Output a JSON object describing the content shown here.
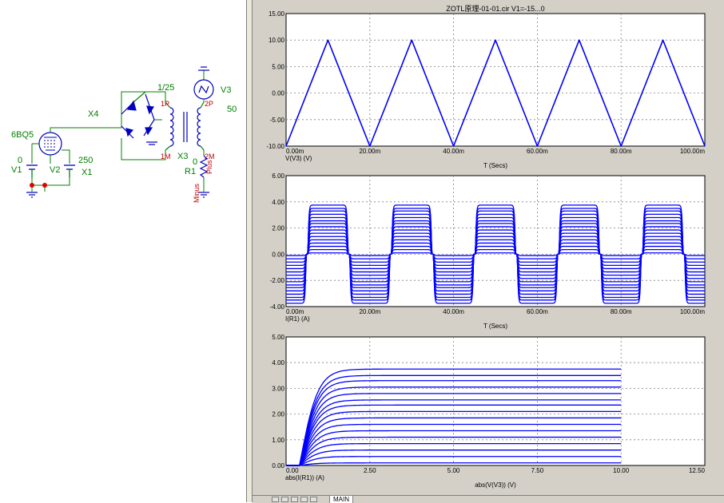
{
  "schematic": {
    "tube_label": "6BQ5",
    "v1_name": "V1",
    "v1_value": "0",
    "v2_name": "V2",
    "v2_value": "250",
    "x1_label": "X1",
    "x4_label": "X4",
    "ratio_label": "1/25",
    "pin_1p": "1P",
    "pin_1m": "1M",
    "x3_label": "X3",
    "pin_plus": "Plus",
    "pin_minus": "Minus",
    "pin_2p": "2P",
    "pin_2m": "2M",
    "v3_name": "V3",
    "v3_value": "50",
    "r1_name": "R1",
    "r1_value": "0"
  },
  "colors": {
    "trace": "#0000ff",
    "schematic_part": "#0000c0",
    "schematic_wire": "#008000",
    "schematic_label": "#008000",
    "pin_label": "#c00000",
    "grid": "#808080",
    "plot_bg": "#ffffff",
    "window_bg": "#d4d0c8"
  },
  "tabs": {
    "main": "MAIN"
  },
  "chart_data": [
    {
      "type": "line",
      "title": "ZOTL原理-01-01.cir V1=-15...0",
      "xlabel": "T (Secs)",
      "ylabel": "V(V3) (V)",
      "xlim": [
        0,
        0.1
      ],
      "ylim": [
        -10,
        15
      ],
      "x_ticks": [
        0,
        0.02,
        0.04,
        0.06,
        0.08,
        0.1
      ],
      "x_tick_labels": [
        "0.00m",
        "20.00m",
        "40.00m",
        "60.00m",
        "80.00m",
        "100.00m"
      ],
      "y_ticks": [
        -10,
        -5,
        0,
        5,
        10,
        15
      ],
      "y_tick_labels": [
        "-10.00",
        "-5.00",
        "0.00",
        "5.00",
        "10.00",
        "15.00"
      ],
      "grid": true,
      "series": [
        {
          "x": [
            0,
            0.01,
            0.02,
            0.03,
            0.04,
            0.05,
            0.06,
            0.07,
            0.08,
            0.09,
            0.1
          ],
          "values": [
            -10,
            10,
            -10,
            10,
            -10,
            10,
            -10,
            10,
            -10,
            10,
            -10
          ]
        }
      ]
    },
    {
      "type": "line",
      "title": "",
      "xlabel": "T (Secs)",
      "ylabel": "I(R1) (A)",
      "xlim": [
        0,
        0.1
      ],
      "ylim": [
        -4,
        6
      ],
      "x_ticks": [
        0,
        0.02,
        0.04,
        0.06,
        0.08,
        0.1
      ],
      "x_tick_labels": [
        "0.00m",
        "20.00m",
        "40.00m",
        "60.00m",
        "80.00m",
        "100.00m"
      ],
      "y_ticks": [
        -4,
        -2,
        0,
        2,
        4,
        6
      ],
      "y_tick_labels": [
        "-4.00",
        "-2.00",
        "0.00",
        "2.00",
        "4.00",
        "6.00"
      ],
      "grid": true,
      "family": {
        "description": "16 parametric current traces (V1 stepped), saturating square-like pulses",
        "saturation_amplitudes": [
          0.1,
          0.35,
          0.6,
          0.85,
          1.1,
          1.35,
          1.6,
          1.85,
          2.1,
          2.35,
          2.55,
          2.8,
          3.05,
          3.3,
          3.5,
          3.75
        ],
        "triangle_period": 0.02,
        "triangle_peak": 10
      }
    },
    {
      "type": "line",
      "title": "",
      "xlabel": "abs(V(V3)) (V)",
      "ylabel": "abs(I(R1)) (A)",
      "xlim": [
        0,
        12.5
      ],
      "ylim": [
        0,
        5
      ],
      "x_ticks": [
        0,
        2.5,
        5,
        7.5,
        10,
        12.5
      ],
      "x_tick_labels": [
        "0.00",
        "2.50",
        "5.00",
        "7.50",
        "10.00",
        "12.50"
      ],
      "y_ticks": [
        0,
        1,
        2,
        3,
        4,
        5
      ],
      "y_tick_labels": [
        "0.00",
        "1.00",
        "2.00",
        "3.00",
        "4.00",
        "5.00"
      ],
      "grid": true,
      "family": {
        "description": "16 parametric I-V curves vs. V1 step, x range 0 to 10",
        "saturation_amplitudes": [
          0.1,
          0.35,
          0.6,
          0.85,
          1.1,
          1.35,
          1.6,
          1.85,
          2.1,
          2.35,
          2.55,
          2.8,
          3.05,
          3.3,
          3.5,
          3.75
        ],
        "x_max": 10
      }
    }
  ]
}
